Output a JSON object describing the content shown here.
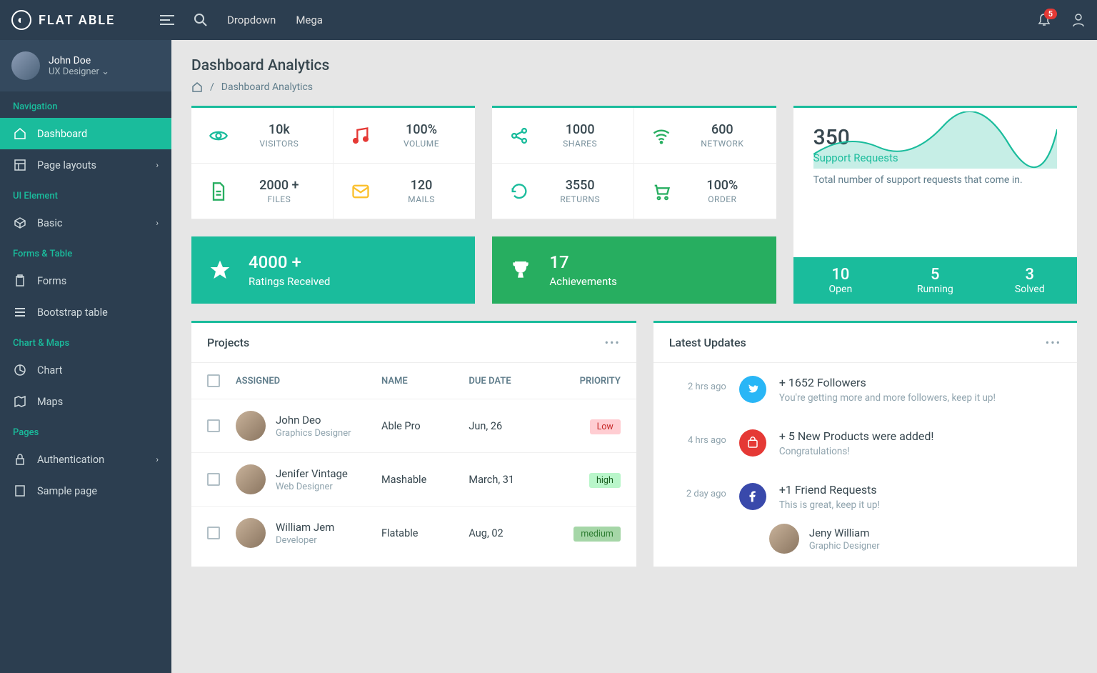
{
  "brand": "FLAT ABLE",
  "headerMenu": {
    "dropdown": "Dropdown",
    "mega": "Mega"
  },
  "notifications": "5",
  "user": {
    "name": "John Doe",
    "role": "UX Designer"
  },
  "sidebar": {
    "sections": [
      {
        "label": "Navigation",
        "items": [
          {
            "label": "Dashboard",
            "active": true
          },
          {
            "label": "Page layouts",
            "chevron": true
          }
        ]
      },
      {
        "label": "UI Element",
        "items": [
          {
            "label": "Basic",
            "chevron": true
          }
        ]
      },
      {
        "label": "Forms & Table",
        "items": [
          {
            "label": "Forms"
          },
          {
            "label": "Bootstrap table"
          }
        ]
      },
      {
        "label": "Chart & Maps",
        "items": [
          {
            "label": "Chart"
          },
          {
            "label": "Maps"
          }
        ]
      },
      {
        "label": "Pages",
        "items": [
          {
            "label": "Authentication",
            "chevron": true
          },
          {
            "label": "Sample page"
          }
        ]
      }
    ]
  },
  "page": {
    "title": "Dashboard Analytics",
    "breadcrumb": "Dashboard Analytics"
  },
  "statsLeft": [
    {
      "value": "10k",
      "label": "VISITORS",
      "icon": "eye",
      "color": "#1abc9c"
    },
    {
      "value": "100%",
      "label": "VOLUME",
      "icon": "music",
      "color": "#e53935"
    },
    {
      "value": "2000 +",
      "label": "FILES",
      "icon": "file",
      "color": "#27ae60"
    },
    {
      "value": "120",
      "label": "MAILS",
      "icon": "mail",
      "color": "#fbc02d"
    }
  ],
  "statsRight": [
    {
      "value": "1000",
      "label": "SHARES",
      "icon": "share",
      "color": "#1abc9c"
    },
    {
      "value": "600",
      "label": "NETWORK",
      "icon": "wifi",
      "color": "#27ae60"
    },
    {
      "value": "3550",
      "label": "RETURNS",
      "icon": "refresh",
      "color": "#1abc9c"
    },
    {
      "value": "100%",
      "label": "ORDER",
      "icon": "cart",
      "color": "#27ae60"
    }
  ],
  "ratings": {
    "value": "4000 +",
    "label": "Ratings Received"
  },
  "achievements": {
    "value": "17",
    "label": "Achievements"
  },
  "support": {
    "count": "350",
    "subtitle": "Support Requests",
    "desc": "Total number of support requests that come in.",
    "stats": [
      {
        "n": "10",
        "l": "Open"
      },
      {
        "n": "5",
        "l": "Running"
      },
      {
        "n": "3",
        "l": "Solved"
      }
    ]
  },
  "projects": {
    "title": "Projects",
    "columns": {
      "assigned": "ASSIGNED",
      "name": "NAME",
      "date": "DUE DATE",
      "priority": "PRIORITY"
    },
    "rows": [
      {
        "name": "John Deo",
        "role": "Graphics Designer",
        "project": "Able Pro",
        "date": "Jun, 26",
        "priority": "Low",
        "cls": "low"
      },
      {
        "name": "Jenifer Vintage",
        "role": "Web Designer",
        "project": "Mashable",
        "date": "March, 31",
        "priority": "high",
        "cls": "high"
      },
      {
        "name": "William Jem",
        "role": "Developer",
        "project": "Flatable",
        "date": "Aug, 02",
        "priority": "medium",
        "cls": "medium"
      }
    ]
  },
  "updates": {
    "title": "Latest Updates",
    "items": [
      {
        "time": "2 hrs ago",
        "icon": "tw",
        "title": "+ 1652 Followers",
        "desc": "You're getting more and more followers, keep it up!"
      },
      {
        "time": "4 hrs ago",
        "icon": "pr",
        "title": "+ 5 New Products were added!",
        "desc": "Congratulations!"
      },
      {
        "time": "2 day ago",
        "icon": "fb",
        "title": "+1 Friend Requests",
        "desc": "This is great, keep it up!"
      }
    ],
    "person": {
      "name": "Jeny William",
      "role": "Graphic Designer"
    }
  }
}
